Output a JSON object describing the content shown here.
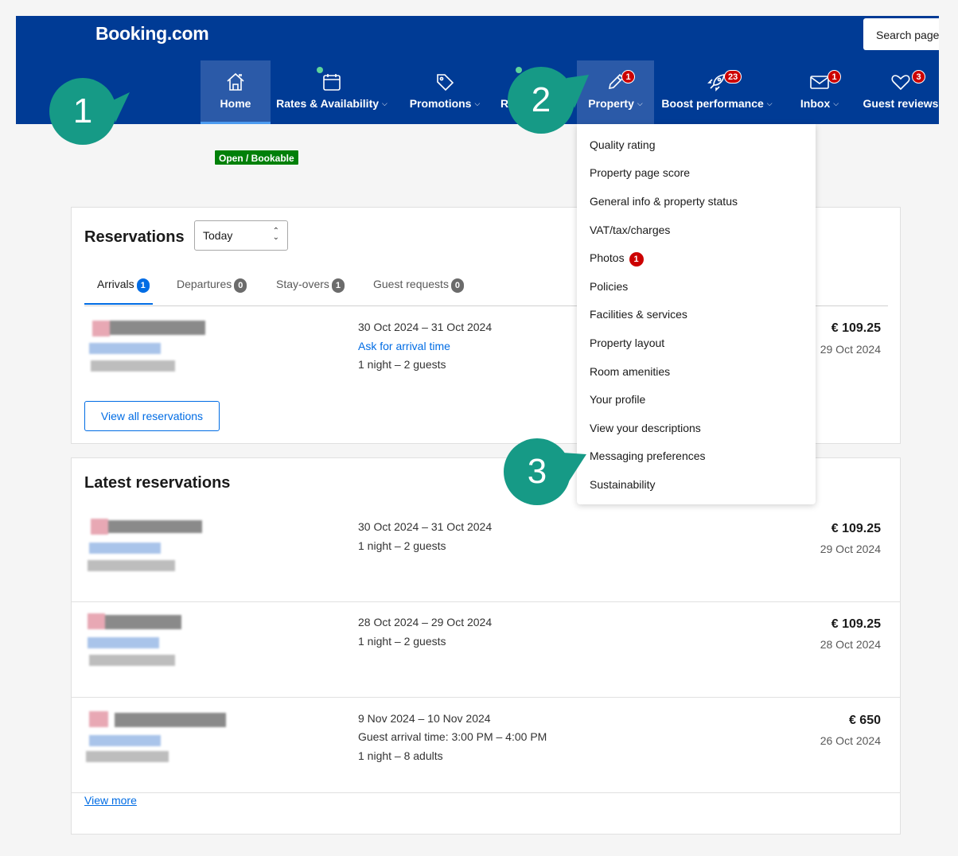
{
  "header": {
    "logo": "Booking.com",
    "search_placeholder": "Search page",
    "nav": [
      {
        "label": "Home",
        "badge": ""
      },
      {
        "label": "Rates & Availability",
        "badge": ""
      },
      {
        "label": "Promotions",
        "badge": ""
      },
      {
        "label": "R",
        "badge": ""
      },
      {
        "label": "Property",
        "badge": "1"
      },
      {
        "label": "Boost performance",
        "badge": "23"
      },
      {
        "label": "Inbox",
        "badge": "1"
      },
      {
        "label": "Guest reviews",
        "badge": "3"
      }
    ],
    "status_badge": "Open / Bookable"
  },
  "callouts": [
    "1",
    "2",
    "3"
  ],
  "property_menu": {
    "items": [
      {
        "label": "Quality rating"
      },
      {
        "label": "Property page score"
      },
      {
        "label": "General info & property status"
      },
      {
        "label": "VAT/tax/charges"
      },
      {
        "label": "Photos",
        "badge": "1"
      },
      {
        "label": "Policies"
      },
      {
        "label": "Facilities & services"
      },
      {
        "label": "Property layout"
      },
      {
        "label": "Room amenities"
      },
      {
        "label": "Your profile"
      },
      {
        "label": "View your descriptions"
      },
      {
        "label": "Messaging preferences"
      },
      {
        "label": "Sustainability"
      }
    ]
  },
  "reservations": {
    "title": "Reservations",
    "period": "Today",
    "tabs": [
      {
        "label": "Arrivals",
        "count": "1"
      },
      {
        "label": "Departures",
        "count": "0"
      },
      {
        "label": "Stay-overs",
        "count": "1"
      },
      {
        "label": "Guest requests",
        "count": "0"
      }
    ],
    "row": {
      "dates": "30 Oct 2024 – 31 Oct 2024",
      "link": "Ask for arrival time",
      "stay": "1 night – 2 guests",
      "amount": "€ 109.25",
      "booked": "29 Oct 2024"
    },
    "view_all": "View all reservations"
  },
  "latest": {
    "title": "Latest reservations",
    "rows": [
      {
        "dates": "30 Oct 2024 – 31 Oct 2024",
        "line2": "1 night – 2 guests",
        "line3": "",
        "amount": "€ 109.25",
        "booked": "29 Oct 2024"
      },
      {
        "dates": "28 Oct 2024 – 29 Oct 2024",
        "line2": "1 night – 2 guests",
        "line3": "",
        "amount": "€ 109.25",
        "booked": "28 Oct 2024"
      },
      {
        "dates": "9 Nov 2024 – 10 Nov 2024",
        "line2": "Guest arrival time: 3:00 PM – 4:00 PM",
        "line3": "1 night – 8 adults",
        "amount": "€ 650",
        "booked": "26 Oct 2024"
      }
    ],
    "view_more": "View more"
  },
  "colors": {
    "header_bg": "#003b95",
    "active_nav": "#2b5aa8",
    "link": "#006ce4",
    "badge_red": "#cc0000",
    "callout_teal": "#169a86",
    "open_green": "#008009"
  }
}
